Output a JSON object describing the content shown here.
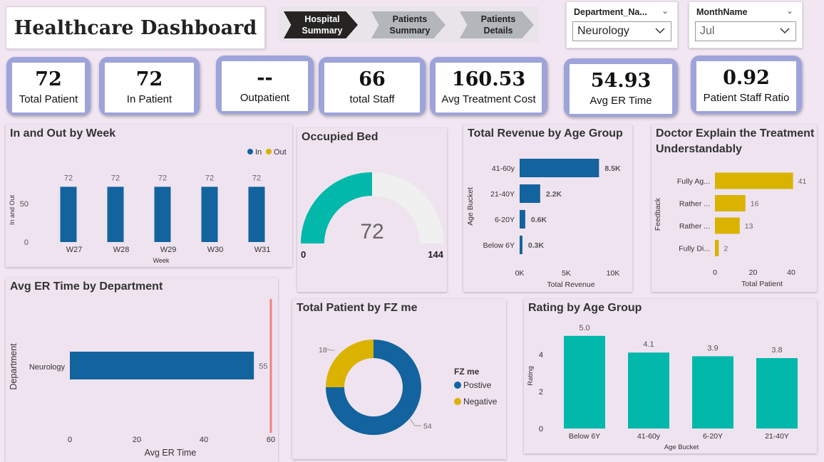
{
  "header": {
    "title": "Healthcare Dashboard"
  },
  "nav": [
    {
      "line1": "Hospital",
      "line2": "Summary",
      "active": true
    },
    {
      "line1": "Patients",
      "line2": "Summary",
      "active": false
    },
    {
      "line1": "Patients",
      "line2": "Details",
      "active": false
    }
  ],
  "filters": {
    "department": {
      "label": "Department_Na...",
      "value": "Neurology"
    },
    "month": {
      "label": "MonthName",
      "value": "Jul"
    }
  },
  "kpis": [
    {
      "value": "72",
      "label": "Total Patient"
    },
    {
      "value": "72",
      "label": "In Patient"
    },
    {
      "value": "--",
      "label": "Outpatient"
    },
    {
      "value": "66",
      "label": "total Staff"
    },
    {
      "value": "160.53",
      "label": "Avg Treatment Cost"
    },
    {
      "value": "54.93",
      "label": "Avg ER Time"
    },
    {
      "value": "0.92",
      "label": "Patient Staff Ratio"
    }
  ],
  "colors": {
    "blue": "#12639e",
    "gold": "#d9b300",
    "teal": "#01b8aa",
    "light_gray": "#f0f0f0",
    "red_line": "#f08080"
  },
  "chart_data": [
    {
      "id": "in-out-week",
      "type": "bar",
      "title": "In and Out by Week",
      "xlabel": "Week",
      "ylabel": "In and Out",
      "categories": [
        "W27",
        "W28",
        "W29",
        "W30",
        "W31"
      ],
      "series": [
        {
          "name": "In",
          "values": [
            72,
            72,
            72,
            72,
            72
          ]
        }
      ],
      "legend": [
        "In",
        "Out"
      ],
      "legend_position": "top-right",
      "yticks": [
        "0",
        "50"
      ],
      "ylim": [
        0,
        90
      ],
      "data_labels": [
        "72",
        "72",
        "72",
        "72",
        "72"
      ]
    },
    {
      "id": "occupied-bed",
      "type": "gauge",
      "title": "Occupied Bed",
      "value": 72,
      "value_label": "72",
      "min": 0,
      "max": 144,
      "min_label": "0",
      "max_label": "144"
    },
    {
      "id": "revenue-age",
      "type": "bar",
      "orientation": "horizontal",
      "title": "Total Revenue by Age Group",
      "xlabel": "Total Revenue",
      "ylabel": "Age Bucket",
      "categories": [
        "41-60y",
        "21-40Y",
        "6-20Y",
        "Below 6Y"
      ],
      "values": [
        8500,
        2200,
        600,
        300
      ],
      "data_labels": [
        "8.5K",
        "2.2K",
        "0.6K",
        "0.3K"
      ],
      "xticks": [
        "0K",
        "5K",
        "10K"
      ],
      "xlim": [
        0,
        10000
      ]
    },
    {
      "id": "doctor-explain",
      "type": "bar",
      "orientation": "horizontal",
      "title_line1": "Doctor Explain the Treatment",
      "title_line2": "Understandably",
      "xlabel": "Total Patient",
      "ylabel": "Feedback",
      "categories": [
        "Fully Ag...",
        "Rather ...",
        "Rather ...",
        "Fully Di..."
      ],
      "values": [
        41,
        16,
        13,
        2
      ],
      "data_labels": [
        "41",
        "16",
        "13",
        "2"
      ],
      "xticks": [
        "0",
        "20",
        "40"
      ],
      "xlim": [
        0,
        46
      ]
    },
    {
      "id": "er-time-dept",
      "type": "bar",
      "orientation": "horizontal",
      "title": "Avg ER Time by Department",
      "xlabel": "Avg ER Time",
      "ylabel": "Department",
      "categories": [
        "Neurology"
      ],
      "values": [
        54.93
      ],
      "data_labels": [
        "55"
      ],
      "reference_line": 60,
      "xticks": [
        "0",
        "20",
        "40",
        "60"
      ],
      "xlim": [
        0,
        60
      ]
    },
    {
      "id": "fz-me",
      "type": "pie",
      "subtype": "donut",
      "title": "Total Patient by FZ me",
      "legend_title": "FZ me",
      "slices": [
        {
          "name": "Postive",
          "value": 54,
          "label": "54"
        },
        {
          "name": "Negative",
          "value": 18,
          "label": "18"
        }
      ]
    },
    {
      "id": "rating-age",
      "type": "bar",
      "title": "Rating by Age Group",
      "xlabel": "Age Bucket",
      "ylabel": "Rating",
      "categories": [
        "Below 6Y",
        "41-60y",
        "6-20Y",
        "21-40Y"
      ],
      "values": [
        5.0,
        4.1,
        3.9,
        3.8
      ],
      "data_labels": [
        "5.0",
        "4.1",
        "3.9",
        "3.8"
      ],
      "yticks": [
        "0",
        "2",
        "4"
      ],
      "ylim": [
        0,
        5.3
      ]
    }
  ]
}
